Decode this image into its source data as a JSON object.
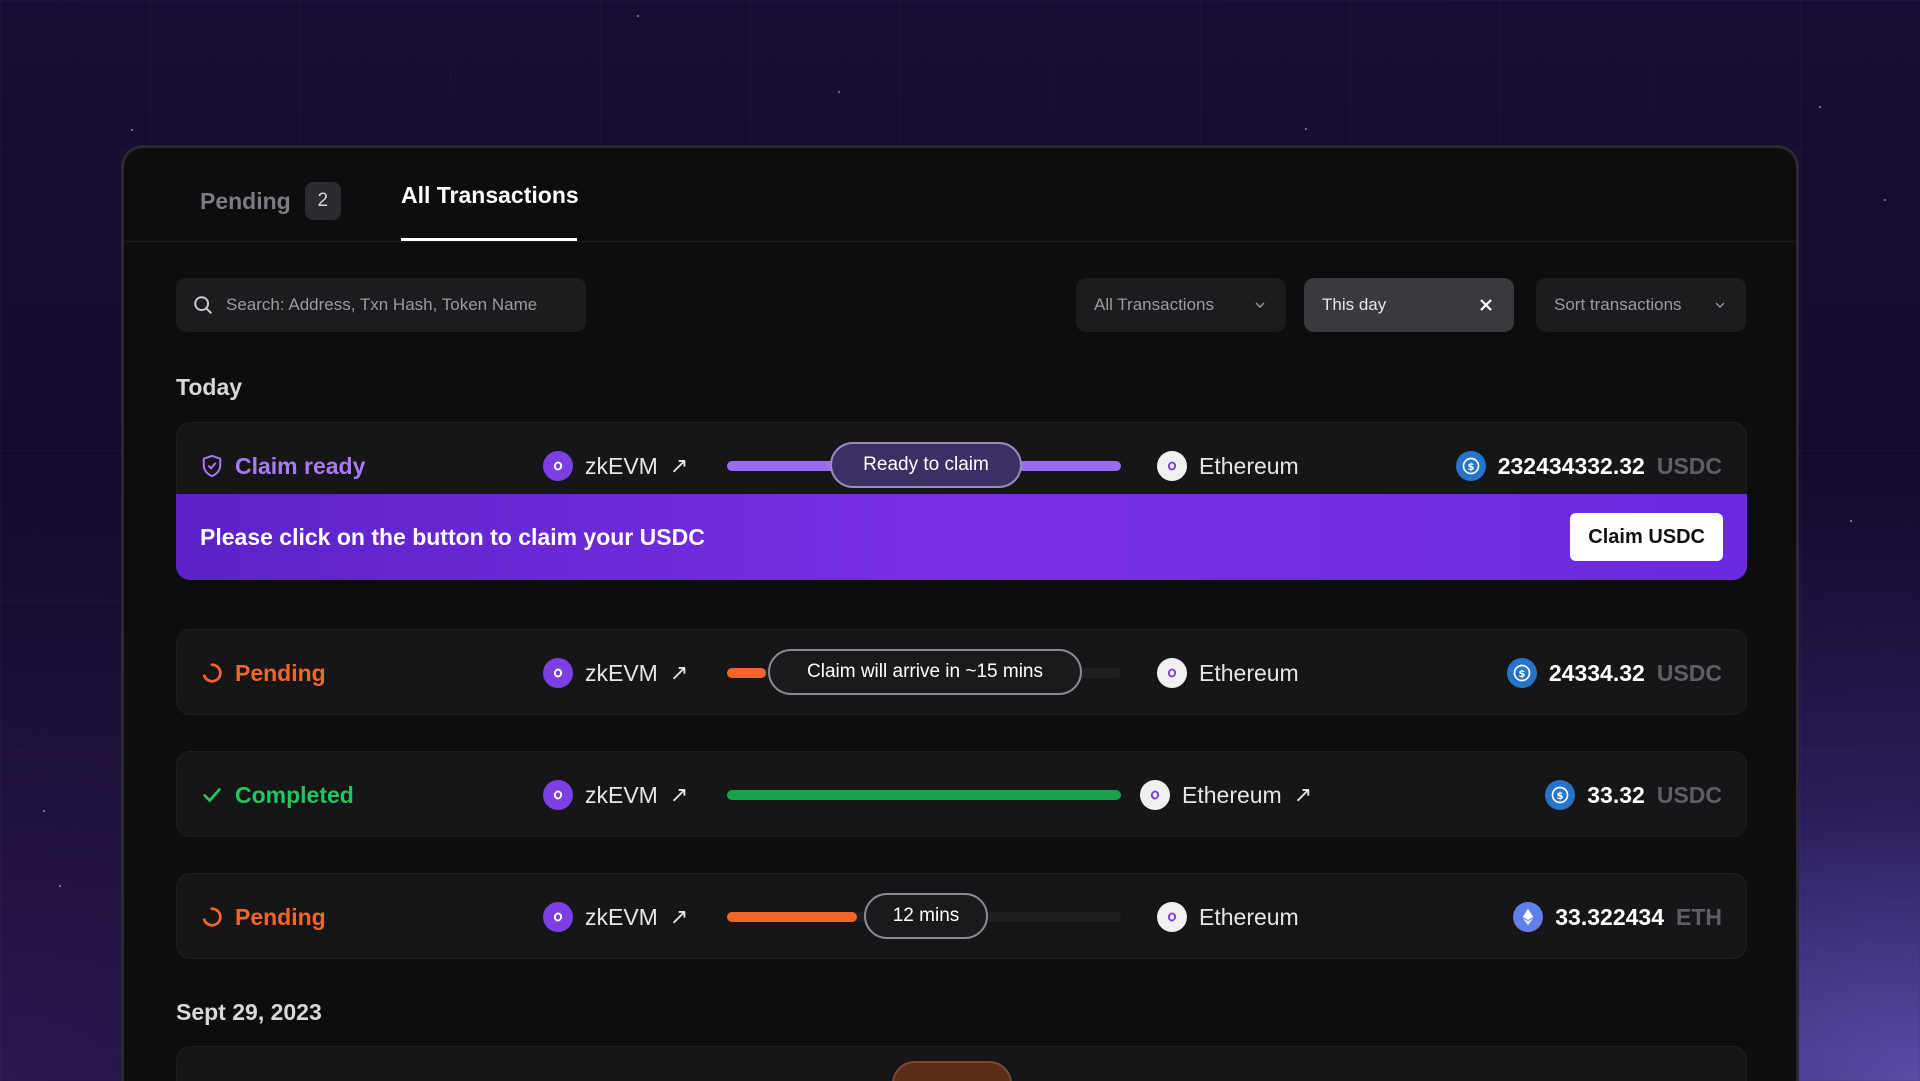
{
  "tabs": {
    "pending_label": "Pending",
    "pending_count": "2",
    "all_label": "All Transactions"
  },
  "filters": {
    "search_placeholder": "Search: Address, Txn Hash, Token Name",
    "type_label": "All Transactions",
    "date_label": "This day",
    "sort_label": "Sort transactions"
  },
  "sections": {
    "today": "Today",
    "sept": "Sept 29, 2023"
  },
  "colors": {
    "claim": "#a97af5",
    "pending": "#f2662a",
    "completed": "#22c55e",
    "purple_track": "#9b6cf0",
    "green_track": "#16a34a",
    "orange_track": "#f2662a"
  },
  "transactions": [
    {
      "status": "Claim ready",
      "status_icon": "shield-check-icon",
      "from": "zkEVM",
      "to": "Ethereum",
      "pill": "Ready to claim",
      "progress": 1.0,
      "amount": "232434332.32",
      "unit": "USDC",
      "coin": "usdc-icon"
    },
    {
      "status": "Pending",
      "status_icon": "spinner-icon",
      "from": "zkEVM",
      "to": "Ethereum",
      "pill": "Claim will arrive in ~15 mins",
      "progress": 0.1,
      "amount": "24334.32",
      "unit": "USDC",
      "coin": "usdc-icon"
    },
    {
      "status": "Completed",
      "status_icon": "check-icon",
      "from": "zkEVM",
      "to": "Ethereum",
      "pill": "",
      "progress": 1.0,
      "amount": "33.32",
      "unit": "USDC",
      "coin": "usdc-icon"
    },
    {
      "status": "Pending",
      "status_icon": "spinner-icon",
      "from": "zkEVM",
      "to": "Ethereum",
      "pill": "12 mins",
      "progress": 0.33,
      "amount": "33.322434",
      "unit": "ETH",
      "coin": "eth-icon"
    }
  ],
  "claim_banner": {
    "text": "Please click on the button to claim your USDC",
    "button": "Claim USDC"
  }
}
